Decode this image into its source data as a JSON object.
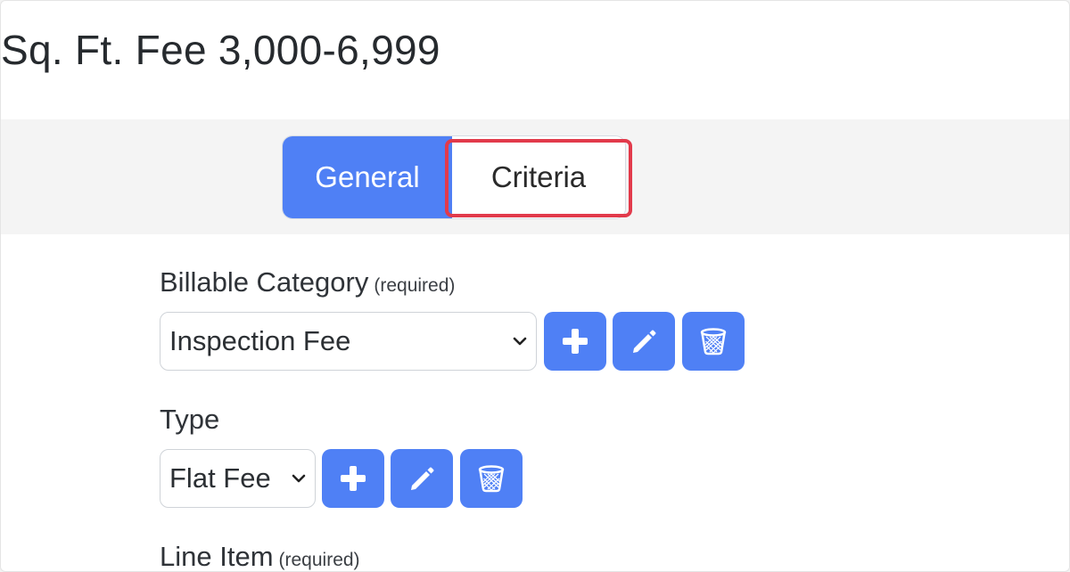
{
  "page": {
    "title": "Sq. Ft. Fee 3,000-6,999"
  },
  "tabs": [
    {
      "label": "General",
      "active": true
    },
    {
      "label": "Criteria",
      "active": false,
      "highlighted": true
    }
  ],
  "fields": {
    "billable_category": {
      "label": "Billable Category",
      "required_note": "(required)",
      "value": "Inspection Fee",
      "buttons": [
        "plus-icon",
        "pencil-icon",
        "trash-icon"
      ]
    },
    "type": {
      "label": "Type",
      "value": "Flat Fee",
      "buttons": [
        "plus-icon",
        "pencil-icon",
        "trash-icon"
      ]
    },
    "line_item": {
      "label": "Line Item",
      "required_note": "(required)"
    }
  },
  "colors": {
    "accent": "#4f80f5",
    "highlight": "#e23a4b",
    "tab_band": "#f4f4f4"
  }
}
